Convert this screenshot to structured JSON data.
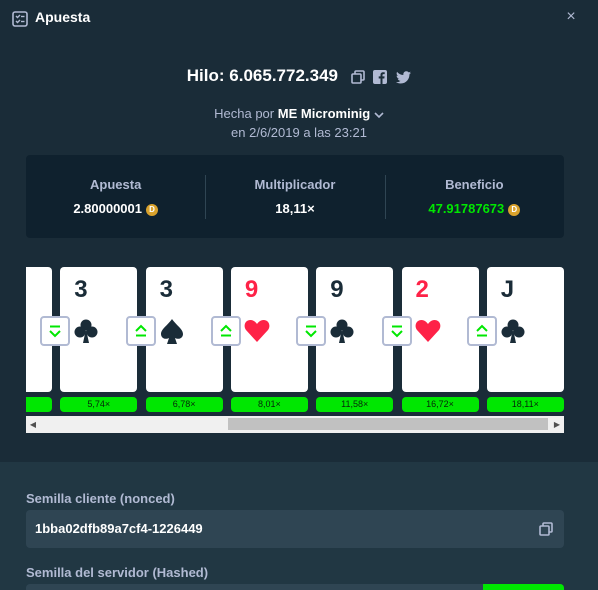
{
  "window": {
    "title": "Apuesta",
    "close_label": "×"
  },
  "game": {
    "title": "Hilo: 6.065.772.349",
    "icons": [
      "copy-icon",
      "facebook-icon",
      "twitter-icon"
    ]
  },
  "author": {
    "prefix": "Hecha por",
    "badge": "ME",
    "name": "Microminig",
    "date": "en 2/6/2019 a las 23:21"
  },
  "stats": {
    "bet_label": "Apuesta",
    "bet_value": "2.80000001",
    "multiplier_label": "Multiplicador",
    "multiplier_value": "18,11×",
    "profit_label": "Beneficio",
    "profit_value": "47.91787673"
  },
  "cards": [
    {
      "rank": "",
      "suit": "",
      "color": "black",
      "guess": "",
      "multiplier": ""
    },
    {
      "rank": "3",
      "suit": "clubs",
      "color": "black",
      "guess": "lower",
      "multiplier": "5,74×"
    },
    {
      "rank": "3",
      "suit": "spades",
      "color": "black",
      "guess": "higher",
      "multiplier": "6,78×"
    },
    {
      "rank": "9",
      "suit": "hearts",
      "color": "red",
      "guess": "higher",
      "multiplier": "8,01×"
    },
    {
      "rank": "9",
      "suit": "clubs",
      "color": "black",
      "guess": "lower",
      "multiplier": "11,58×"
    },
    {
      "rank": "2",
      "suit": "hearts",
      "color": "red",
      "guess": "lower",
      "multiplier": "16,72×"
    },
    {
      "rank": "J",
      "suit": "clubs",
      "color": "black",
      "guess": "higher",
      "multiplier": "18,11×"
    }
  ],
  "colors": {
    "background": "#1a2c38",
    "panel": "#0f212e",
    "green": "#00e701",
    "red": "#fe2247"
  },
  "seeds": {
    "client_label": "Semilla cliente (nonced)",
    "client_value": "1bba02dfb89a7cf4-1226449",
    "server_label": "Semilla del servidor (Hashed)"
  }
}
